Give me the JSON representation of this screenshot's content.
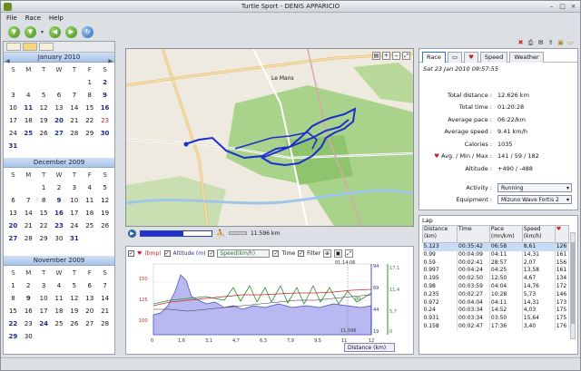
{
  "window": {
    "title": "Turtle Sport - DENIS APPARICIO"
  },
  "menu": [
    "File",
    "Race",
    "Help"
  ],
  "icons": {
    "toolbar": [
      "down-arrow-icon",
      "chevron-down-icon",
      "back-icon",
      "forward-icon",
      "refresh-icon"
    ],
    "accent": "#2233cc"
  },
  "calendars": [
    {
      "title": "January 2010",
      "dow": [
        "S",
        "M",
        "T",
        "W",
        "T",
        "F",
        "S"
      ],
      "weeks": [
        [
          "",
          "",
          "",
          "",
          "",
          "1",
          "2"
        ],
        [
          "3",
          "4",
          "5",
          "6",
          "7",
          "8",
          "9"
        ],
        [
          "10",
          "11",
          "12",
          "13",
          "14",
          "15",
          "16"
        ],
        [
          "17",
          "18",
          "19",
          "20",
          "21",
          "22",
          "23"
        ],
        [
          "24",
          "25",
          "26",
          "27",
          "28",
          "29",
          "30"
        ],
        [
          "31",
          "",
          "",
          "",
          "",
          "",
          ""
        ]
      ]
    },
    {
      "title": "December 2009",
      "dow": [
        "S",
        "M",
        "T",
        "W",
        "T",
        "F",
        "S"
      ],
      "weeks": [
        [
          "",
          "",
          "1",
          "2",
          "3",
          "4",
          "5"
        ],
        [
          "6",
          "7",
          "8",
          "9",
          "10",
          "11",
          "12"
        ],
        [
          "13",
          "14",
          "15",
          "16",
          "17",
          "18",
          "19"
        ],
        [
          "20",
          "21",
          "22",
          "23",
          "24",
          "25",
          "26"
        ],
        [
          "27",
          "28",
          "29",
          "30",
          "31",
          "",
          ""
        ]
      ]
    },
    {
      "title": "November 2009",
      "dow": [
        "S",
        "M",
        "T",
        "W",
        "T",
        "F",
        "S"
      ],
      "weeks": [
        [
          "1",
          "2",
          "3",
          "4",
          "5",
          "6",
          "7"
        ],
        [
          "8",
          "9",
          "10",
          "11",
          "12",
          "13",
          "14"
        ],
        [
          "15",
          "16",
          "17",
          "18",
          "19",
          "20",
          "21"
        ],
        [
          "22",
          "23",
          "24",
          "25",
          "26",
          "27",
          "28"
        ],
        [
          "29",
          "30",
          "",
          "",
          "",
          "",
          ""
        ]
      ]
    }
  ],
  "map": {
    "labels": [
      "Le Mans"
    ],
    "distance_readout": "11.596 km",
    "progress": 0.6
  },
  "graph": {
    "cb_heart": "(bmp)",
    "cb_altitude": "Altitude (m)",
    "speed_select": "Speed(km/h)",
    "cb_time": "Time",
    "cb_filter": "Filter",
    "distance_select": "Distance (km)",
    "cursor_label": "01:14:06",
    "cursor_dist": "11,596",
    "left_axis": [
      "150",
      "125",
      "100"
    ],
    "right_axis": [
      "94",
      "69",
      "44",
      "19"
    ],
    "far_axis": [
      "17,1",
      "11,4",
      "5,7",
      "0"
    ],
    "x_ticks": [
      "0",
      "1,6",
      "3,1",
      "4,7",
      "6,3",
      "7,9",
      "9,5",
      "11",
      "12"
    ],
    "marker_value": "80"
  },
  "summary": {
    "tabs": [
      "Race",
      "Speed",
      "Weather"
    ],
    "date": "Sat 23 Jan 2010 09:57:55",
    "rows": [
      {
        "label": "Total distance :",
        "value": "12.626 km"
      },
      {
        "label": "Total time :",
        "value": "01:20:28"
      },
      {
        "label": "Average pace :",
        "value": "06:22/km"
      },
      {
        "label": "Average speed :",
        "value": "9.41 km/h"
      },
      {
        "label": "Calories :",
        "value": "1035"
      },
      {
        "label": "Avg. / Min / Max :",
        "value": "141 / 59 / 182"
      },
      {
        "label": "Altitude :",
        "value": "+490 / -488"
      }
    ],
    "activity_label": "Activity :",
    "activity_value": "Running",
    "equipment_label": "Equipment :",
    "equipment_value": "Mizuno Wave Fortis 2"
  },
  "lap": {
    "title": "Lap",
    "headers": [
      "Distance (km)",
      "Time",
      "Pace (mn/km)",
      "Speed (km/h)"
    ],
    "rows": [
      [
        "5.123",
        "00:35:42",
        "06:58",
        "8,61",
        "126"
      ],
      [
        "0.99",
        "00:04:09",
        "04:11",
        "14,31",
        "161"
      ],
      [
        "0.59",
        "00:02:41",
        "28:57",
        "2,07",
        "156"
      ],
      [
        "0.997",
        "00:04:24",
        "04:25",
        "13,58",
        "161"
      ],
      [
        "0.195",
        "00:02:50",
        "12:50",
        "4,67",
        "134"
      ],
      [
        "0.98",
        "00:03:59",
        "04:04",
        "14,76",
        "172"
      ],
      [
        "0.235",
        "00:02:27",
        "10:28",
        "5,73",
        "146"
      ],
      [
        "0.972",
        "00:04:04",
        "04:11",
        "14,31",
        "173"
      ],
      [
        "0.24",
        "00:03:34",
        "14:52",
        "4,03",
        "175"
      ],
      [
        "0.931",
        "00:03:34",
        "03:50",
        "15,64",
        "175"
      ],
      [
        "0.158",
        "00:02:47",
        "17:36",
        "3,40",
        "176"
      ]
    ]
  }
}
